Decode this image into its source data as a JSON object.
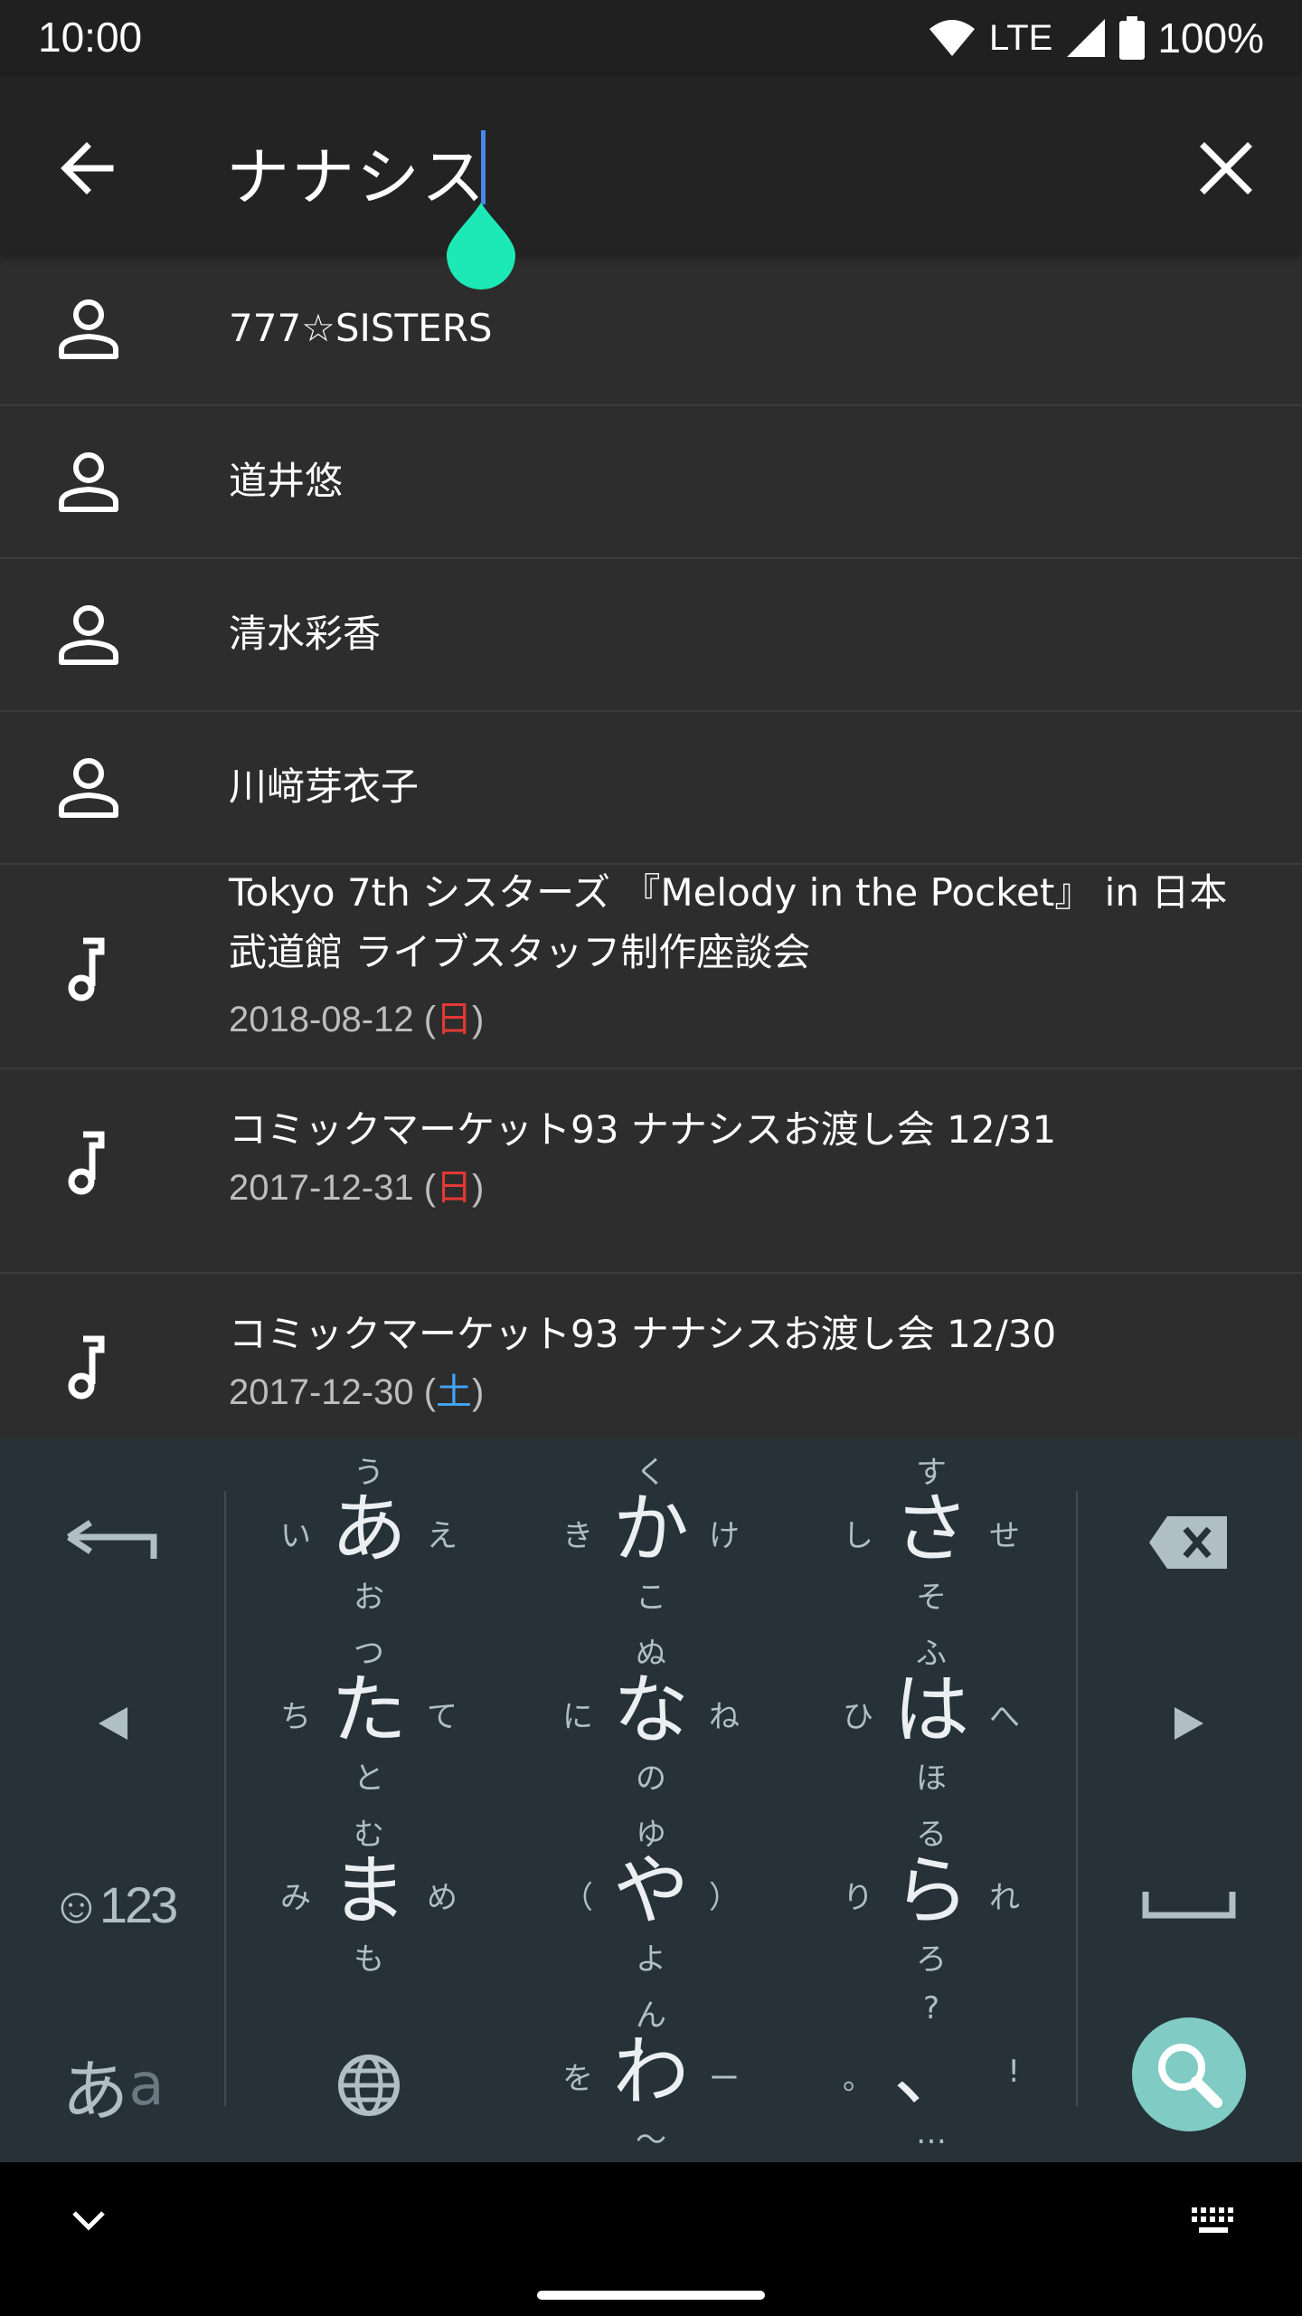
{
  "status_bar": {
    "time": "10:00",
    "network": "LTE",
    "battery": "100%"
  },
  "search": {
    "query": "ナナシス"
  },
  "results": {
    "people": [
      {
        "name": "777☆SISTERS"
      },
      {
        "name": "道井悠"
      },
      {
        "name": "清水彩香"
      },
      {
        "name": "川﨑芽衣子"
      }
    ],
    "events": [
      {
        "title_line1": "Tokyo 7th シスターズ 『Melody in the Pocket』 in 日本",
        "title_line2": "武道館 ライブスタッフ制作座談会",
        "date": "2018-08-12 (",
        "day": "日",
        "close": ")"
      },
      {
        "title_line1": "コミックマーケット93 ナナシスお渡し会 12/31",
        "date": "2017-12-31 (",
        "day": "日",
        "close": ")"
      },
      {
        "title_line1": "コミックマーケット93 ナナシスお渡し会 12/30",
        "date": "2017-12-30 (",
        "day": "土",
        "close": ")"
      }
    ]
  },
  "keyboard": {
    "keys": {
      "a": {
        "main": "あ",
        "t": "う",
        "b": "お",
        "l": "い",
        "r": "え"
      },
      "ka": {
        "main": "か",
        "t": "く",
        "b": "こ",
        "l": "き",
        "r": "け"
      },
      "sa": {
        "main": "さ",
        "t": "す",
        "b": "そ",
        "l": "し",
        "r": "せ"
      },
      "ta": {
        "main": "た",
        "t": "つ",
        "b": "と",
        "l": "ち",
        "r": "て"
      },
      "na": {
        "main": "な",
        "t": "ぬ",
        "b": "の",
        "l": "に",
        "r": "ね"
      },
      "ha": {
        "main": "は",
        "t": "ふ",
        "b": "ほ",
        "l": "ひ",
        "r": "へ"
      },
      "ma": {
        "main": "ま",
        "t": "む",
        "b": "も",
        "l": "み",
        "r": "め"
      },
      "ya": {
        "main": "や",
        "t": "ゆ",
        "b": "よ",
        "l": "（",
        "r": "）"
      },
      "ra": {
        "main": "ら",
        "t": "る",
        "b": "ろ",
        "l": "り",
        "r": "れ"
      },
      "wa": {
        "main": "わ",
        "t": "ん",
        "b": "〜",
        "l": "を",
        "r": "ー"
      },
      "punct": {
        "main": "、",
        "t": "?",
        "b": "…",
        "l": "。",
        "r": "!"
      }
    },
    "emoji_label": "☺123",
    "mode_label_main": "あ",
    "mode_label_sub": "a"
  },
  "colors": {
    "accent_handle": "#1de9b6",
    "caret": "#4a86e8",
    "search_key": "#80cbc4",
    "sunday": "#e53935",
    "saturday": "#42a5f5"
  }
}
